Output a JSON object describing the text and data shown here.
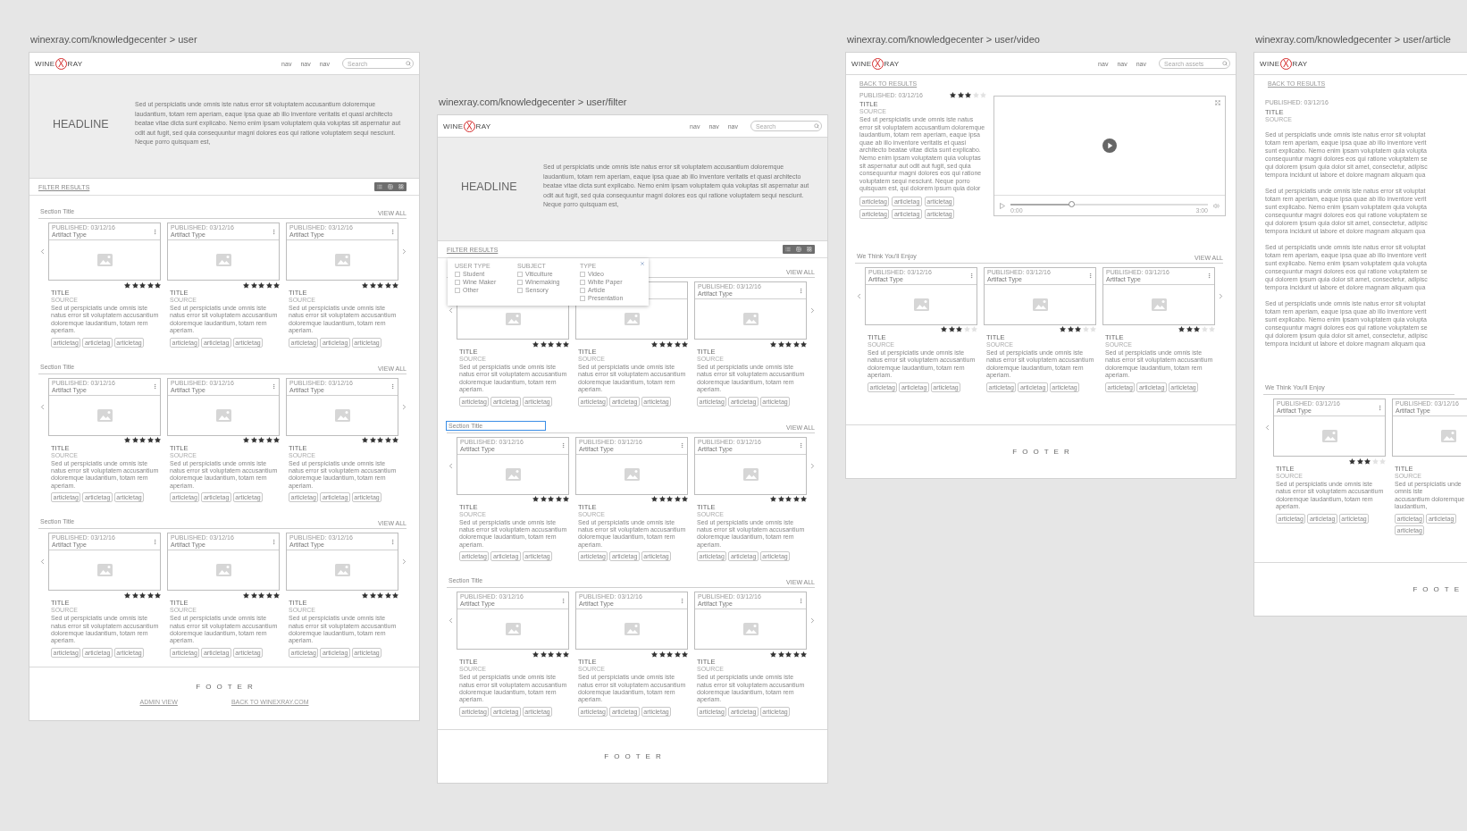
{
  "canvas_frames": [
    {
      "kind": "listing",
      "url_label": "winexray.com/knowledgecenter > user",
      "header": {
        "logo": {
          "left": "WINE",
          "mark": "X",
          "right": "RAY"
        },
        "nav": [
          "nav",
          "nav",
          "nav"
        ],
        "search": {
          "placeholder": "Search"
        }
      },
      "hero": {
        "headline": "HEADLINE",
        "text": "Sed ut perspiciatis unde omnis iste natus error sit voluptatem accusantium doloremque laudantium, totam rem aperiam, eaque ipsa quae ab illo inventore veritatis et quasi architecto beatae vitae dicta sunt explicabo. Nemo enim ipsam voluptatem quia voluptas sit aspernatur aut odit aut fugit, sed quia consequuntur magni dolores eos qui ratione voluptatem sequi nesciunt. Neque porro quisquam est,"
      },
      "filter_bar": {
        "label": "FILTER RESULTS"
      },
      "sections": [
        {
          "title": "Section Title",
          "selected": false,
          "view_all": "VIEW ALL",
          "cards": [
            {
              "published": "PUBLISHED: 03/12/16",
              "type": "Artifact Type",
              "stars": 5,
              "title": "TITLE",
              "source": "SOURCE",
              "description": "Sed ut perspiciatis unde omnis iste natus error sit voluptatem accusantium doloremque laudantium, totam rem aperiam.",
              "tags": [
                "articletag",
                "articletag",
                "articletag"
              ]
            },
            {
              "published": "PUBLISHED: 03/12/16",
              "type": "Artifact Type",
              "stars": 5,
              "title": "TITLE",
              "source": "SOURCE",
              "description": "Sed ut perspiciatis unde omnis iste natus error sit voluptatem accusantium doloremque laudantium, totam rem aperiam.",
              "tags": [
                "articletag",
                "articletag",
                "articletag"
              ]
            },
            {
              "published": "PUBLISHED: 03/12/16",
              "type": "Artifact Type",
              "stars": 5,
              "title": "TITLE",
              "source": "SOURCE",
              "description": "Sed ut perspiciatis unde omnis iste natus error sit voluptatem accusantium doloremque laudantium, totam rem aperiam.",
              "tags": [
                "articletag",
                "articletag",
                "articletag"
              ]
            }
          ]
        },
        {
          "title": "Section Title",
          "selected": false,
          "view_all": "VIEW ALL",
          "cards": [
            {
              "published": "PUBLISHED: 03/12/16",
              "type": "Artifact Type",
              "stars": 5,
              "title": "TITLE",
              "source": "SOURCE",
              "description": "Sed ut perspiciatis unde omnis iste natus error sit voluptatem accusantium doloremque laudantium, totam rem aperiam.",
              "tags": [
                "articletag",
                "articletag",
                "articletag"
              ]
            },
            {
              "published": "PUBLISHED: 03/12/16",
              "type": "Artifact Type",
              "stars": 5,
              "title": "TITLE",
              "source": "SOURCE",
              "description": "Sed ut perspiciatis unde omnis iste natus error sit voluptatem accusantium doloremque laudantium, totam rem aperiam.",
              "tags": [
                "articletag",
                "articletag",
                "articletag"
              ]
            },
            {
              "published": "PUBLISHED: 03/12/16",
              "type": "Artifact Type",
              "stars": 5,
              "title": "TITLE",
              "source": "SOURCE",
              "description": "Sed ut perspiciatis unde omnis iste natus error sit voluptatem accusantium doloremque laudantium, totam rem aperiam.",
              "tags": [
                "articletag",
                "articletag",
                "articletag"
              ]
            }
          ]
        },
        {
          "title": "Section Title",
          "selected": false,
          "view_all": "VIEW ALL",
          "cards": [
            {
              "published": "PUBLISHED: 03/12/16",
              "type": "Artifact Type",
              "stars": 5,
              "title": "TITLE",
              "source": "SOURCE",
              "description": "Sed ut perspiciatis unde omnis iste natus error sit voluptatem accusantium doloremque laudantium, totam rem aperiam.",
              "tags": [
                "articletag",
                "articletag",
                "articletag"
              ]
            },
            {
              "published": "PUBLISHED: 03/12/16",
              "type": "Artifact Type",
              "stars": 5,
              "title": "TITLE",
              "source": "SOURCE",
              "description": "Sed ut perspiciatis unde omnis iste natus error sit voluptatem accusantium doloremque laudantium, totam rem aperiam.",
              "tags": [
                "articletag",
                "articletag",
                "articletag"
              ]
            },
            {
              "published": "PUBLISHED: 03/12/16",
              "type": "Artifact Type",
              "stars": 5,
              "title": "TITLE",
              "source": "SOURCE",
              "description": "Sed ut perspiciatis unde omnis iste natus error sit voluptatem accusantium doloremque laudantium, totam rem aperiam.",
              "tags": [
                "articletag",
                "articletag",
                "articletag"
              ]
            }
          ]
        }
      ],
      "footer": {
        "label": "FOOTER",
        "links": [
          "ADMIN VIEW",
          "BACK TO WINEXRAY.COM"
        ]
      }
    },
    {
      "kind": "listing",
      "url_label": "winexray.com/knowledgecenter > user/filter",
      "header": {
        "logo": {
          "left": "WINE",
          "mark": "X",
          "right": "RAY"
        },
        "nav": [
          "nav",
          "nav",
          "nav"
        ],
        "search": {
          "placeholder": "Search"
        }
      },
      "hero": {
        "headline": "HEADLINE",
        "text": "Sed ut perspiciatis unde omnis iste natus error sit voluptatem accusantium doloremque laudantium, totam rem aperiam, eaque ipsa quae ab illo inventore veritatis et quasi architecto beatae vitae dicta sunt explicabo. Nemo enim ipsam voluptatem quia voluptas sit aspernatur aut odit aut fugit, sed quia consequuntur magni dolores eos qui ratione voluptatem sequi nesciunt. Neque porro quisquam est,"
      },
      "filter_bar": {
        "label": "FILTER RESULTS"
      },
      "filter_panel": {
        "groups": [
          {
            "heading": "USER TYPE",
            "options": [
              {
                "label": "Student",
                "checked": false
              },
              {
                "label": "Wine Maker",
                "checked": false
              },
              {
                "label": "Other",
                "checked": false
              }
            ]
          },
          {
            "heading": "SUBJECT",
            "options": [
              {
                "label": "Viticulture",
                "checked": false
              },
              {
                "label": "Winemaking",
                "checked": false
              },
              {
                "label": "Sensory",
                "checked": false
              }
            ]
          },
          {
            "heading": "TYPE",
            "options": [
              {
                "label": "Video",
                "checked": false
              },
              {
                "label": "White Paper",
                "checked": false
              },
              {
                "label": "Article",
                "checked": false
              },
              {
                "label": "Presentation",
                "checked": false
              }
            ]
          }
        ]
      },
      "sections": [
        {
          "view_all": "VIEW ALL",
          "cards": [
            {
              "stars": 5,
              "title": "TITLE",
              "source": "SOURCE",
              "description": "Sed ut perspiciatis unde omnis iste natus error sit voluptatem accusantium doloremque laudantium, totam rem aperiam.",
              "tags": [
                "articletag",
                "articletag",
                "articletag"
              ]
            },
            {
              "stars": 5,
              "title": "TITLE",
              "source": "SOURCE",
              "description": "Sed ut perspiciatis unde omnis iste natus error sit voluptatem accusantium doloremque laudantium, totam rem aperiam.",
              "tags": [
                "articletag",
                "articletag",
                "articletag"
              ]
            },
            {
              "published": "PUBLISHED: 03/12/16",
              "type": "Artifact Type",
              "stars": 5,
              "title": "TITLE",
              "source": "SOURCE",
              "description": "Sed ut perspiciatis unde omnis iste natus error sit voluptatem accusantium doloremque laudantium, totam rem aperiam.",
              "tags": [
                "articletag",
                "articletag",
                "articletag"
              ]
            }
          ]
        },
        {
          "title": "Section Title",
          "selected": true,
          "view_all": "VIEW ALL",
          "cards": [
            {
              "published": "PUBLISHED: 03/12/16",
              "type": "Artifact Type",
              "stars": 5,
              "title": "TITLE",
              "source": "SOURCE",
              "description": "Sed ut perspiciatis unde omnis iste natus error sit voluptatem accusantium doloremque laudantium, totam rem aperiam.",
              "tags": [
                "articletag",
                "articletag",
                "articletag"
              ]
            },
            {
              "published": "PUBLISHED: 03/12/16",
              "type": "Artifact Type",
              "stars": 5,
              "title": "TITLE",
              "source": "SOURCE",
              "description": "Sed ut perspiciatis unde omnis iste natus error sit voluptatem accusantium doloremque laudantium, totam rem aperiam.",
              "tags": [
                "articletag",
                "articletag",
                "articletag"
              ]
            },
            {
              "published": "PUBLISHED: 03/12/16",
              "type": "Artifact Type",
              "stars": 5,
              "title": "TITLE",
              "source": "SOURCE",
              "description": "Sed ut perspiciatis unde omnis iste natus error sit voluptatem accusantium doloremque laudantium, totam rem aperiam.",
              "tags": [
                "articletag",
                "articletag",
                "articletag"
              ]
            }
          ]
        },
        {
          "title": "Section Title",
          "selected": false,
          "view_all": "VIEW ALL",
          "cards": [
            {
              "published": "PUBLISHED: 03/12/16",
              "type": "Artifact Type",
              "stars": 5,
              "title": "TITLE",
              "source": "SOURCE",
              "description": "Sed ut perspiciatis unde omnis iste natus error sit voluptatem accusantium doloremque laudantium, totam rem aperiam.",
              "tags": [
                "articletag",
                "articletag",
                "articletag"
              ]
            },
            {
              "published": "PUBLISHED: 03/12/16",
              "type": "Artifact Type",
              "stars": 5,
              "title": "TITLE",
              "source": "SOURCE",
              "description": "Sed ut perspiciatis unde omnis iste natus error sit voluptatem accusantium doloremque laudantium, totam rem aperiam.",
              "tags": [
                "articletag",
                "articletag",
                "articletag"
              ]
            },
            {
              "published": "PUBLISHED: 03/12/16",
              "type": "Artifact Type",
              "stars": 5,
              "title": "TITLE",
              "source": "SOURCE",
              "description": "Sed ut perspiciatis unde omnis iste natus error sit voluptatem accusantium doloremque laudantium, totam rem aperiam.",
              "tags": [
                "articletag",
                "articletag",
                "articletag"
              ]
            }
          ]
        }
      ],
      "footer": {
        "label": "FOOTER"
      }
    },
    {
      "kind": "video",
      "url_label": "winexray.com/knowledgecenter > user/video",
      "header": {
        "logo": {
          "left": "WINE",
          "mark": "X",
          "right": "RAY"
        },
        "nav": [
          "nav",
          "nav",
          "nav"
        ],
        "search": {
          "placeholder": "Search assets"
        }
      },
      "back_link": "BACK TO RESULTS",
      "detail": {
        "published": "PUBLISHED: 03/12/16",
        "stars": 3,
        "title": "TITLE",
        "source": "SOURCE",
        "text": "Sed ut perspiciatis unde omnis iste natus error sit voluptatem accusantium doloremque laudantium, totam rem aperiam, eaque ipsa quae ab illo inventore veritatis et quasi architecto beatae vitae dicta sunt explicabo. Nemo enim ipsam voluptatem quia voluptas sit aspernatur aut odit aut fugit, sed quia consequuntur magni dolores eos qui ratione voluptatem sequi nesciunt. Neque porro quisquam est, qui dolorem ipsum quia dolor",
        "tags": [
          "articletag",
          "articletag",
          "articletag",
          "articletag",
          "articletag",
          "articletag"
        ]
      },
      "player": {
        "progress": {
          "level": 0.31
        },
        "elapsed": "0:00",
        "duration": "3:00"
      },
      "sections": [
        {
          "title": "We Think You'll Enjoy",
          "selected": false,
          "view_all": "VIEW ALL",
          "cards": [
            {
              "published": "PUBLISHED: 03/12/16",
              "type": "Artifact Type",
              "stars": 3,
              "title": "TITLE",
              "source": "SOURCE",
              "description": "Sed ut perspiciatis unde omnis iste natus error sit voluptatem accusantium doloremque laudantium, totam rem aperiam.",
              "tags": [
                "articletag",
                "articletag",
                "articletag"
              ]
            },
            {
              "published": "PUBLISHED: 03/12/16",
              "type": "Artifact Type",
              "stars": 3,
              "title": "TITLE",
              "source": "SOURCE",
              "description": "Sed ut perspiciatis unde omnis iste natus error sit voluptatem accusantium doloremque laudantium, totam rem aperiam.",
              "tags": [
                "articletag",
                "articletag",
                "articletag"
              ]
            },
            {
              "published": "PUBLISHED: 03/12/16",
              "type": "Artifact Type",
              "stars": 3,
              "title": "TITLE",
              "source": "SOURCE",
              "description": "Sed ut perspiciatis unde omnis iste natus error sit voluptatem accusantium doloremque laudantium, totam rem aperiam.",
              "tags": [
                "articletag",
                "articletag",
                "articletag"
              ]
            }
          ]
        }
      ],
      "footer": {
        "label": "FOOTER"
      }
    },
    {
      "kind": "article",
      "url_label": "winexray.com/knowledgecenter > user/article",
      "header": {
        "logo": {
          "left": "WINE",
          "mark": "X",
          "right": "RAY"
        }
      },
      "back_link": "BACK TO RESULTS",
      "article": {
        "published": "PUBLISHED: 03/12/16",
        "title": "TITLE",
        "source": "SOURCE",
        "paragraphs": [
          "Sed ut perspiciatis unde omnis iste natus error sit voluptat\ntotam rem aperiam, eaque ipsa quae ab illo inventore verit\nsunt explicabo. Nemo enim ipsam voluptatem quia volupta\nconsequuntur magni dolores eos qui ratione voluptatem se\nqui dolorem ipsum quia dolor sit amet, consectetur, adipisc\ntempora incidunt ut labore et dolore magnam aliquam qua",
          "Sed ut perspiciatis unde omnis iste natus error sit voluptat\ntotam rem aperiam, eaque ipsa quae ab illo inventore verit\nsunt explicabo. Nemo enim ipsam voluptatem quia volupta\nconsequuntur magni dolores eos qui ratione voluptatem se\nqui dolorem ipsum quia dolor sit amet, consectetur, adipisc\ntempora incidunt ut labore et dolore magnam aliquam qua",
          "Sed ut perspiciatis unde omnis iste natus error sit voluptat\ntotam rem aperiam, eaque ipsa quae ab illo inventore verit\nsunt explicabo. Nemo enim ipsam voluptatem quia volupta\nconsequuntur magni dolores eos qui ratione voluptatem se\nqui dolorem ipsum quia dolor sit amet, consectetur, adipisc\ntempora incidunt ut labore et dolore magnam aliquam qua",
          "Sed ut perspiciatis unde omnis iste natus error sit voluptat\ntotam rem aperiam, eaque ipsa quae ab illo inventore verit\nsunt explicabo. Nemo enim ipsam voluptatem quia volupta\nconsequuntur magni dolores eos qui ratione voluptatem se\nqui dolorem ipsum quia dolor sit amet, consectetur, adipisc\ntempora incidunt ut labore et dolore magnam aliquam qua"
        ]
      },
      "sections": [
        {
          "title": "We Think You'll Enjoy",
          "selected": false,
          "cards": [
            {
              "published": "PUBLISHED: 03/12/16",
              "type": "Artifact Type",
              "stars": 3,
              "title": "TITLE",
              "source": "SOURCE",
              "description": "Sed ut perspiciatis unde omnis iste natus error sit voluptatem accusantium doloremque laudantium, totam rem aperiam.",
              "tags": [
                "articletag",
                "articletag",
                "articletag"
              ]
            },
            {
              "published": "PUBLISHED: 03/12/16",
              "type": "Artifact Type",
              "title": "TITLE",
              "source": "SOURCE",
              "description": "Sed ut perspiciatis unde omnis iste\naccusantium doloremque laudantium,",
              "tags": [
                "articletag",
                "articletag",
                "articletag"
              ]
            }
          ]
        }
      ],
      "footer": {
        "label": "FOOTE"
      }
    }
  ]
}
